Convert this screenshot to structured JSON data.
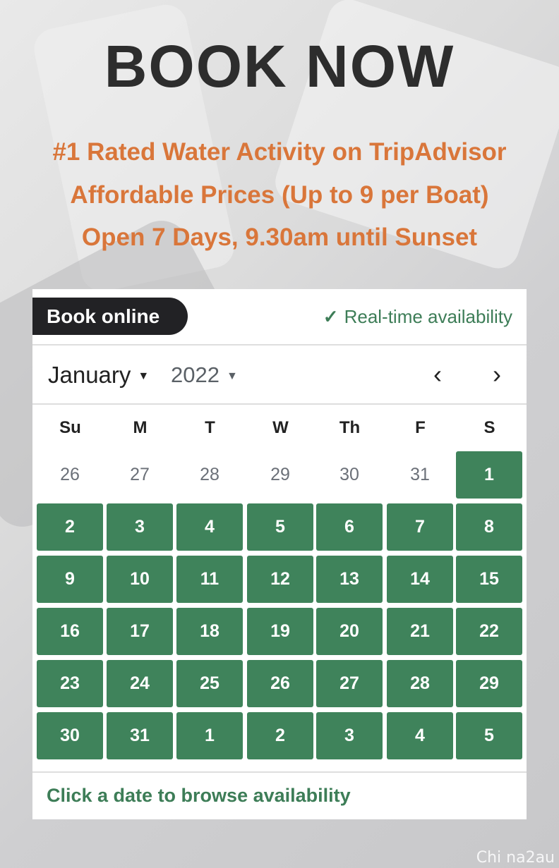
{
  "headline": "BOOK NOW",
  "sublines": [
    "#1 Rated Water Activity on TripAdvisor",
    "Affordable Prices (Up to 9 per Boat)",
    "Open 7 Days, 9.30am until Sunset"
  ],
  "widget": {
    "book_label": "Book online",
    "availability_label": "Real-time availability",
    "check_glyph": "✓",
    "month": "January",
    "year": "2022",
    "caret_glyph": "▼",
    "prev_glyph": "‹",
    "next_glyph": "›",
    "weekdays": [
      "Su",
      "M",
      "T",
      "W",
      "Th",
      "F",
      "S"
    ],
    "days": [
      [
        "26",
        "27",
        "28",
        "29",
        "30",
        "31",
        "1"
      ],
      [
        "2",
        "3",
        "4",
        "5",
        "6",
        "7",
        "8"
      ],
      [
        "9",
        "10",
        "11",
        "12",
        "13",
        "14",
        "15"
      ],
      [
        "16",
        "17",
        "18",
        "19",
        "20",
        "21",
        "22"
      ],
      [
        "23",
        "24",
        "25",
        "26",
        "27",
        "28",
        "29"
      ],
      [
        "30",
        "31",
        "1",
        "2",
        "3",
        "4",
        "5"
      ]
    ],
    "footer_text": "Click a date to browse availability"
  },
  "colors": {
    "accent_green": "#3f835b",
    "headline_orange": "#d9763a",
    "pill_dark": "#222225"
  },
  "watermark": "Chi na2au"
}
